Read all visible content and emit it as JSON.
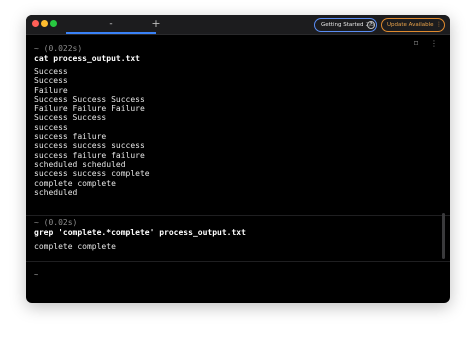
{
  "titlebar": {
    "tab_label": "-",
    "new_tab_label": "+",
    "getting_started_label": "Getting Started",
    "getting_started_progress": "2/5",
    "help_label": "?",
    "update_label": "Update Available",
    "update_menu": "⋮"
  },
  "toolbar": {
    "bookmark_icon": "⌑",
    "more_icon": "⋮"
  },
  "block1": {
    "meta": "~ (0.022s)",
    "command": "cat process_output.txt",
    "output": "Success\nSuccess\nFailure\nSuccess Success Success\nFailure Failure Failure\nSuccess Success\nsuccess\nsuccess failure\nsuccess success success\nsuccess failure failure\nscheduled scheduled\nsuccess success complete\ncomplete complete\nscheduled"
  },
  "block2": {
    "meta": "~ (0.02s)",
    "command": "grep 'complete.*complete' process_output.txt",
    "output": "complete complete"
  },
  "prompt": {
    "symbol": "~"
  },
  "colors": {
    "background": "#000000",
    "titlebar": "#1c1c1e",
    "accent_blue": "#3a82f7",
    "update_orange": "#e08a2e"
  }
}
